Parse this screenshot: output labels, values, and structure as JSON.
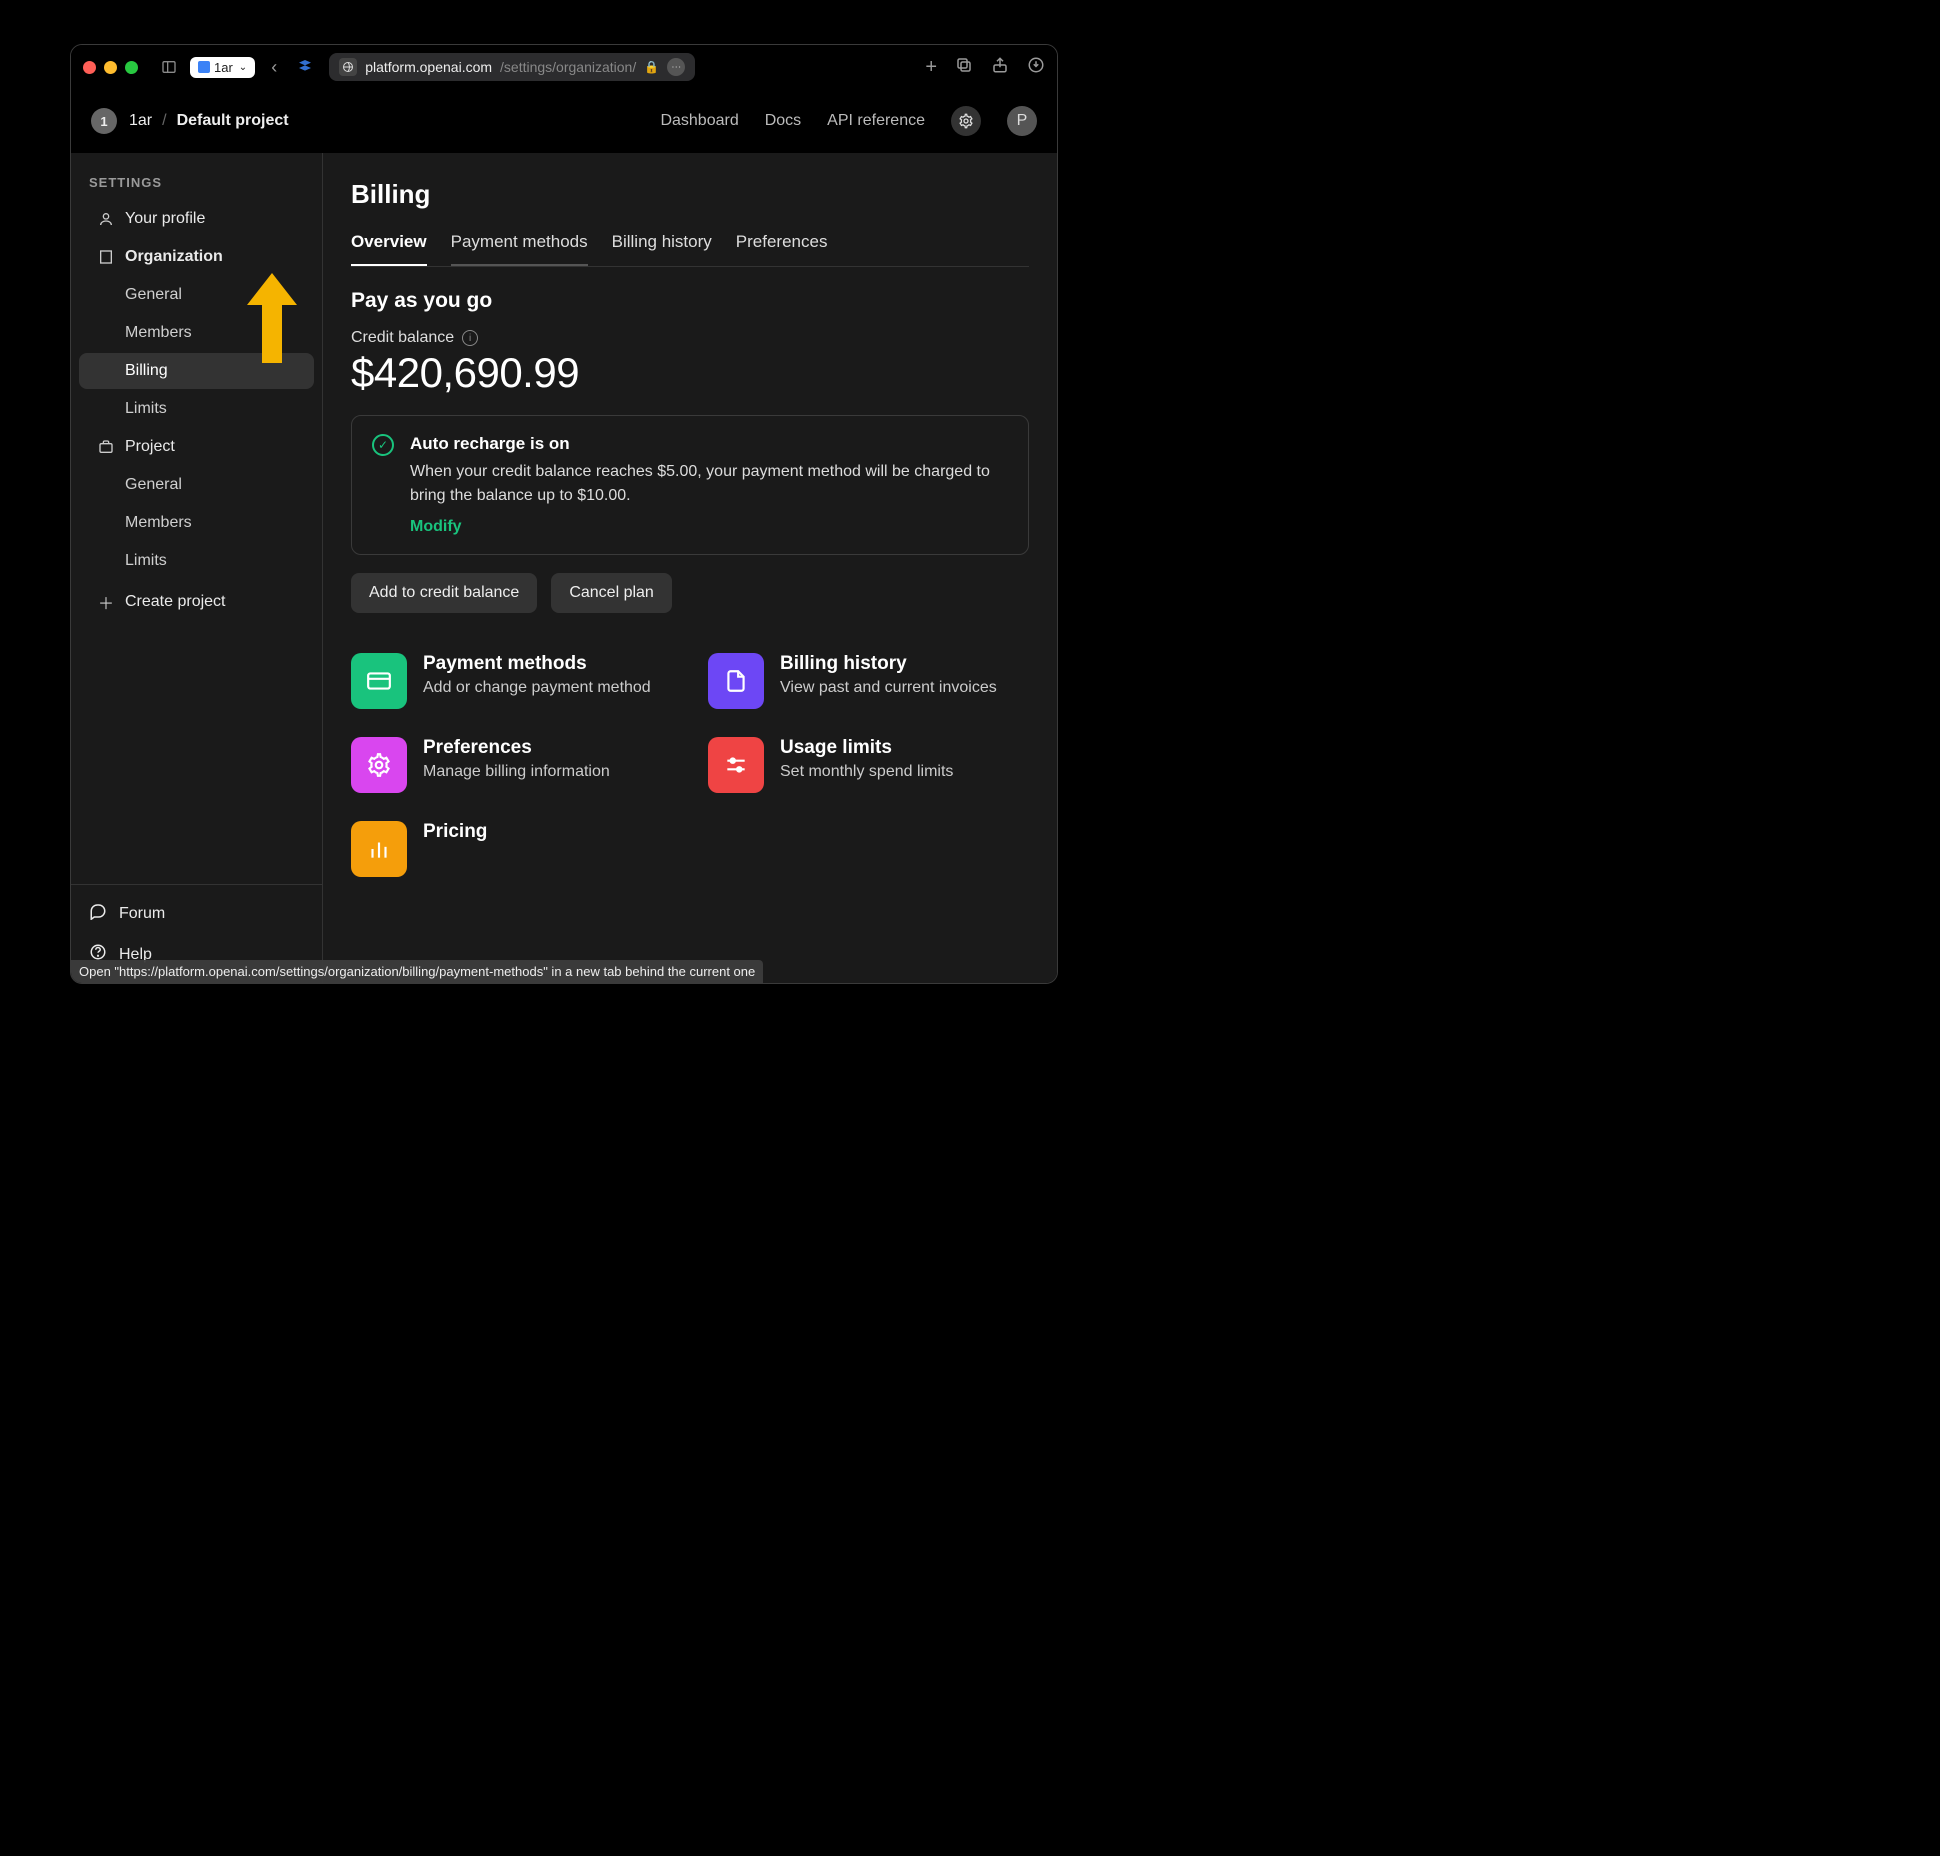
{
  "titlebar": {
    "tab_label": "1ar",
    "url_host": "platform.openai.com",
    "url_path": "/settings/organization/"
  },
  "header": {
    "org_badge": "1",
    "org_name": "1ar",
    "breadcrumb_sep": "/",
    "project_name": "Default project",
    "links": [
      "Dashboard",
      "Docs",
      "API reference"
    ],
    "avatar_initial": "P"
  },
  "sidebar": {
    "heading": "SETTINGS",
    "your_profile": "Your profile",
    "organization": "Organization",
    "org_items": [
      "General",
      "Members",
      "Billing",
      "Limits"
    ],
    "project": "Project",
    "proj_items": [
      "General",
      "Members",
      "Limits"
    ],
    "create_project": "Create project",
    "footer": {
      "forum": "Forum",
      "help": "Help"
    }
  },
  "main": {
    "title": "Billing",
    "tabs": [
      "Overview",
      "Payment methods",
      "Billing history",
      "Preferences"
    ],
    "section_heading": "Pay as you go",
    "balance_label": "Credit balance",
    "balance_value": "$420,690.99",
    "callout": {
      "title": "Auto recharge is on",
      "desc": "When your credit balance reaches $5.00, your payment method will be charged to bring the balance up to $10.00.",
      "modify": "Modify"
    },
    "buttons": {
      "add": "Add to credit balance",
      "cancel": "Cancel plan"
    },
    "cards": [
      {
        "title": "Payment methods",
        "desc": "Add or change payment method",
        "icon": "card-icon",
        "color": "ci-green"
      },
      {
        "title": "Billing history",
        "desc": "View past and current invoices",
        "icon": "file-icon",
        "color": "ci-purple"
      },
      {
        "title": "Preferences",
        "desc": "Manage billing information",
        "icon": "gear-icon",
        "color": "ci-pink"
      },
      {
        "title": "Usage limits",
        "desc": "Set monthly spend limits",
        "icon": "sliders-icon",
        "color": "ci-red"
      },
      {
        "title": "Pricing",
        "desc": "",
        "icon": "chart-icon",
        "color": "ci-orange"
      }
    ]
  },
  "status_tip": "Open \"https://platform.openai.com/settings/organization/billing/payment-methods\" in a new tab behind the current one"
}
